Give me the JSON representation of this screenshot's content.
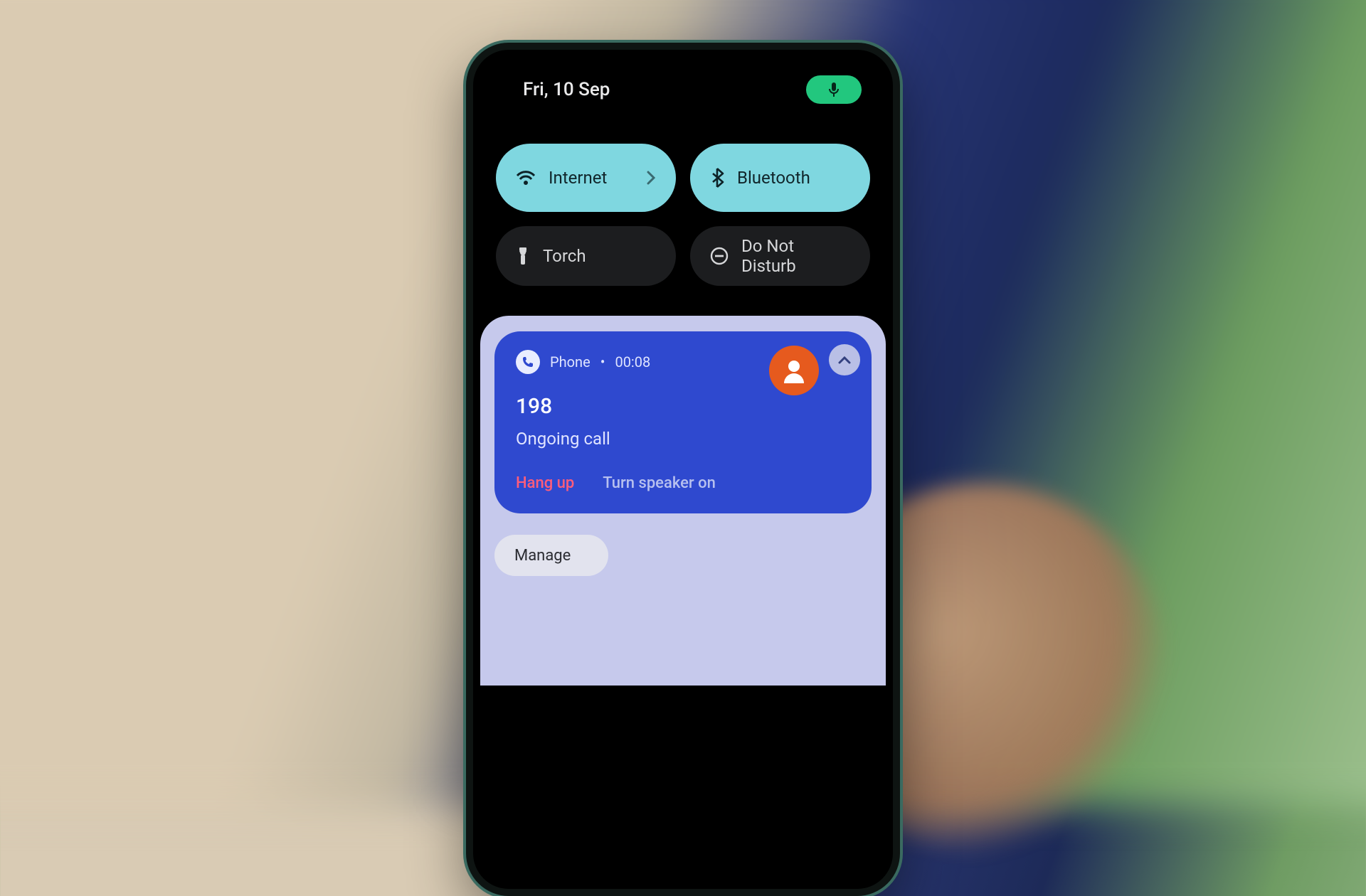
{
  "status": {
    "date": "Fri, 10 Sep",
    "mic_active": true
  },
  "quick_settings": {
    "internet": {
      "label": "Internet",
      "active": true,
      "icon": "wifi-icon",
      "has_chevron": true
    },
    "bluetooth": {
      "label": "Bluetooth",
      "active": true,
      "icon": "bluetooth-icon",
      "has_chevron": false
    },
    "torch": {
      "label": "Torch",
      "active": false,
      "icon": "flashlight-icon"
    },
    "dnd": {
      "label": "Do Not Disturb",
      "active": false,
      "icon": "dnd-icon"
    }
  },
  "notification": {
    "app_name": "Phone",
    "separator": "•",
    "duration": "00:08",
    "caller_number": "198",
    "call_status": "Ongoing call",
    "actions": {
      "hang_up": "Hang up",
      "speaker": "Turn speaker on"
    }
  },
  "tray": {
    "manage_label": "Manage"
  },
  "colors": {
    "tile_active": "#7fd7e0",
    "tile_inactive": "#1c1d1f",
    "notif_bg": "#2f49cf",
    "avatar_bg": "#e65a1e",
    "mic_chip": "#22c77e",
    "hangup": "#ff5d7a"
  }
}
